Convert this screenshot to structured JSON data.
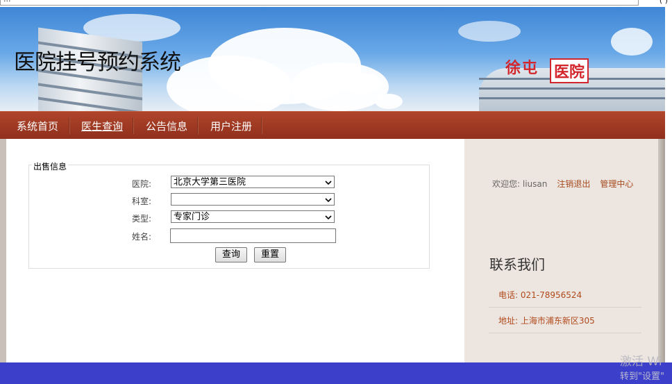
{
  "browser": {
    "url_fragment": "...",
    "control_glyph": "(  )"
  },
  "banner": {
    "title": "医院挂号预约系统",
    "sign_text": "徐屯",
    "sign_text2": "医院"
  },
  "nav": {
    "items": [
      {
        "label": "系统首页"
      },
      {
        "label": "医生查询"
      },
      {
        "label": "公告信息"
      },
      {
        "label": "用户注册"
      }
    ]
  },
  "form": {
    "legend": "出售信息",
    "hospital_label": "医院:",
    "hospital_value": "北京大学第三医院",
    "department_label": "科室:",
    "department_value": "",
    "type_label": "类型:",
    "type_value": "专家门诊",
    "name_label": "姓名:",
    "name_value": "",
    "query_button": "查询",
    "reset_button": "重置"
  },
  "sidebar": {
    "welcome_text": "欢迎您: liusan",
    "logout_link": "注销退出",
    "admin_link": "管理中心",
    "contact_title": "联系我们",
    "phone": "电话:  021-78956524",
    "address": "地址:  上海市浦东新区305"
  },
  "system": {
    "watermark_line1": "激活 Wi",
    "watermark_line2": "转到\"设置\""
  },
  "colors": {
    "nav": "#9b3a22",
    "footer": "#3b3fc9",
    "sidebar": "#ede5df",
    "link": "#a64a1f"
  }
}
